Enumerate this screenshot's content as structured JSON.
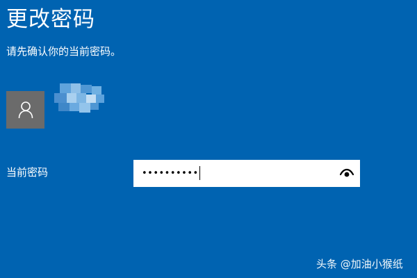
{
  "header": {
    "title": "更改密码",
    "subtitle": "请先确认你的当前密码。"
  },
  "account": {
    "avatar_icon": "user-icon"
  },
  "form": {
    "current_password_label": "当前密码",
    "current_password_value": "••••••••••",
    "reveal_icon": "eye-icon"
  },
  "watermark": {
    "text": "头条 @加油小猴纸"
  },
  "colors": {
    "background": "#0063b1",
    "avatar_bg": "#6b6b6b",
    "input_bg": "#ffffff"
  }
}
